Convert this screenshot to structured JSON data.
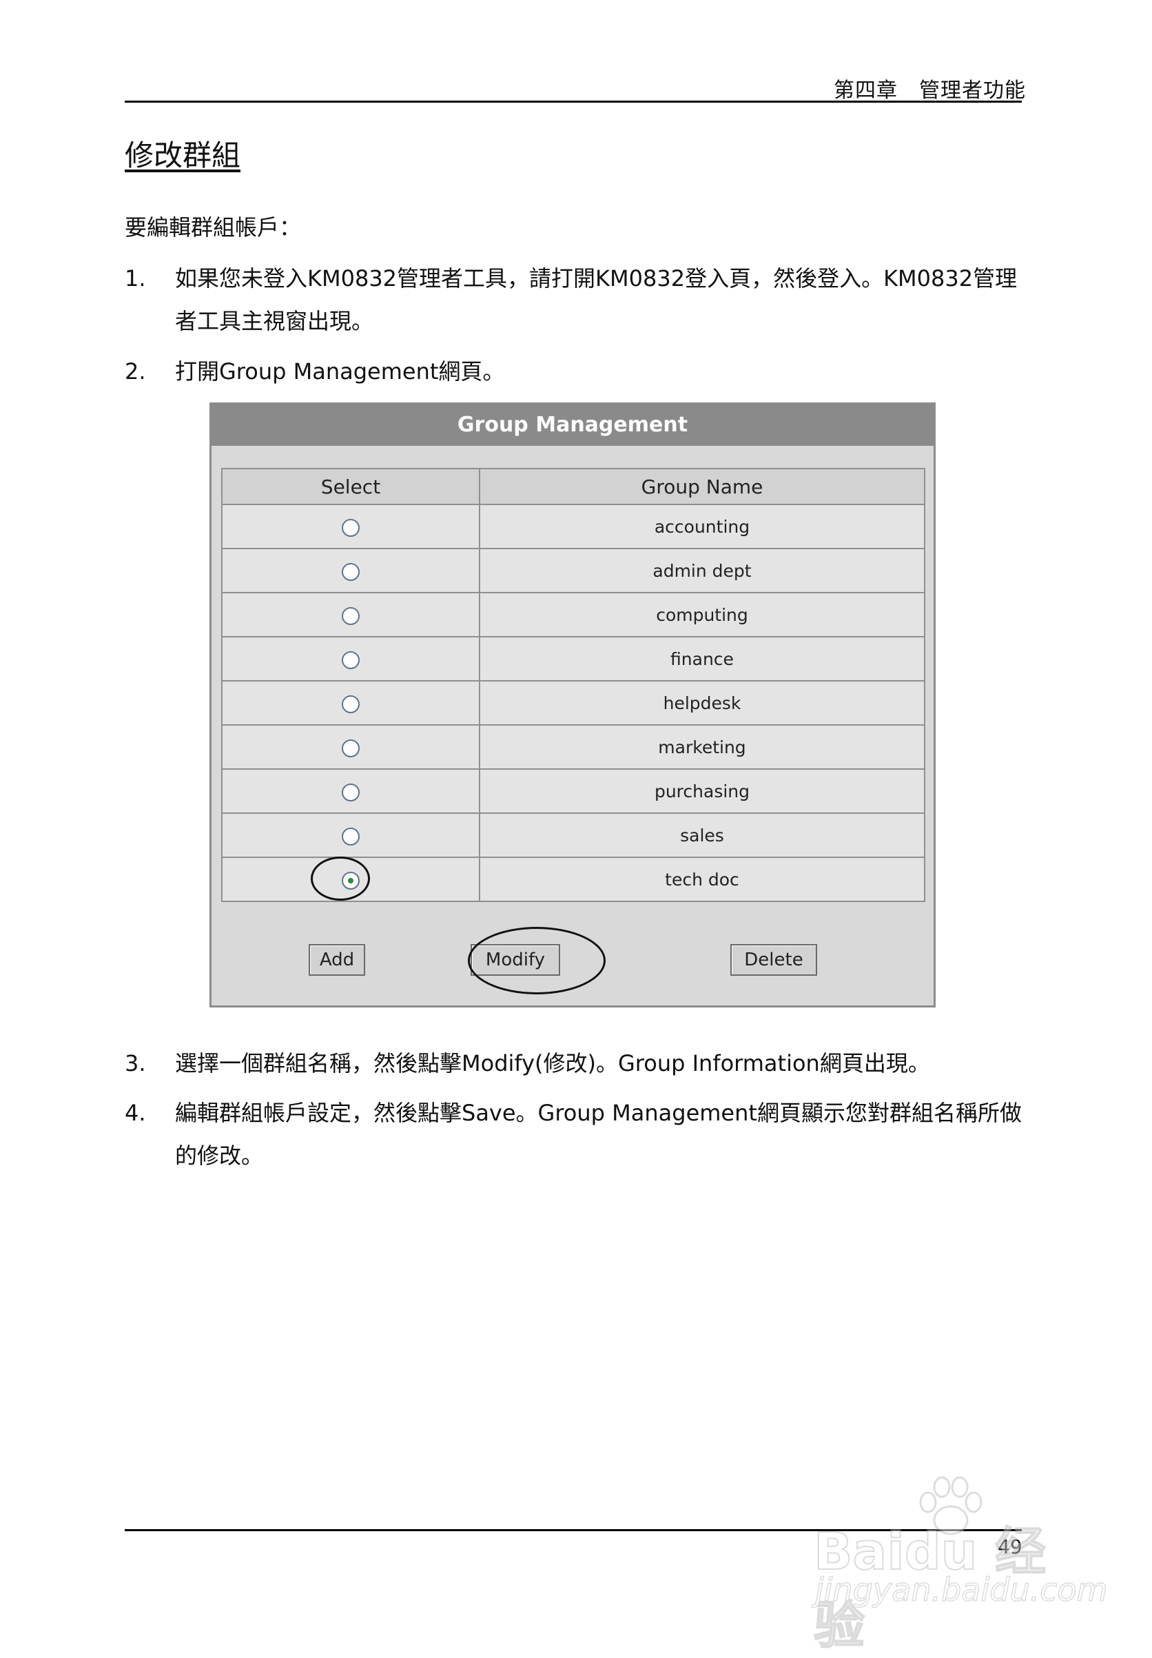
{
  "header": {
    "chapter": "第四章　管理者功能"
  },
  "section": {
    "title": "修改群組"
  },
  "intro": "要編輯群組帳戶：",
  "steps": [
    {
      "num": "1.",
      "text": "如果您未登入KM0832管理者工具，請打開KM0832登入頁，然後登入。KM0832管理者工具主視窗出現。"
    },
    {
      "num": "2.",
      "text": "打開Group Management網頁。"
    },
    {
      "num": "3.",
      "text": "選擇一個群組名稱，然後點擊Modify(修改)。Group Information網頁出現。"
    },
    {
      "num": "4.",
      "text": "編輯群組帳戶設定，然後點擊Save。Group Management網頁顯示您對群組名稱所做的修改。"
    }
  ],
  "group_management": {
    "title": "Group Management",
    "columns": [
      "Select",
      "Group Name"
    ],
    "rows": [
      {
        "name": "accounting",
        "selected": false
      },
      {
        "name": "admin dept",
        "selected": false
      },
      {
        "name": "computing",
        "selected": false
      },
      {
        "name": "finance",
        "selected": false
      },
      {
        "name": "helpdesk",
        "selected": false
      },
      {
        "name": "marketing",
        "selected": false
      },
      {
        "name": "purchasing",
        "selected": false
      },
      {
        "name": "sales",
        "selected": false
      },
      {
        "name": "tech doc",
        "selected": true
      }
    ],
    "buttons": {
      "add": "Add",
      "modify": "Modify",
      "delete": "Delete"
    }
  },
  "footer": {
    "page_number": "49"
  },
  "watermark": {
    "brand": "Baidu 经验",
    "url": "jingyan.baidu.com"
  }
}
